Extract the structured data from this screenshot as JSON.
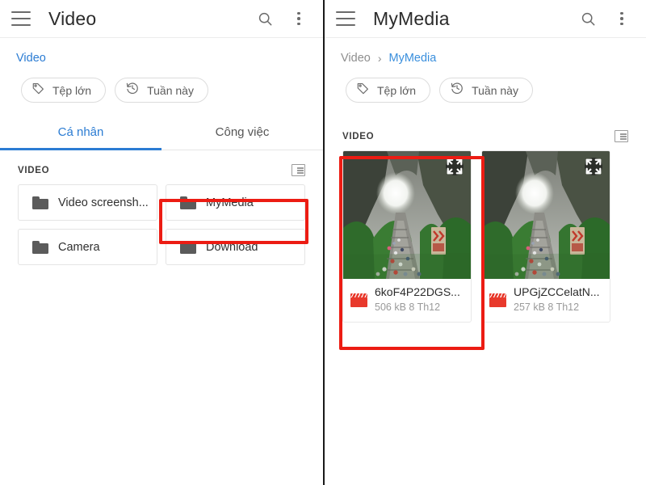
{
  "left_panel": {
    "appbar": {
      "menu_icon": "hamburger-menu-icon",
      "title": "Video",
      "search_icon": "search-icon",
      "overflow_icon": "more-vertical-icon"
    },
    "breadcrumb": [
      {
        "label": "Video",
        "state": "link"
      }
    ],
    "chips": [
      {
        "label": "Tệp lớn",
        "icon": "tag-icon"
      },
      {
        "label": "Tuần này",
        "icon": "history-icon"
      }
    ],
    "tabs": [
      {
        "label": "Cá nhân",
        "active": true
      },
      {
        "label": "Công việc",
        "active": false
      }
    ],
    "section": {
      "title": "VIDEO",
      "view_toggle_icon": "list-view-icon"
    },
    "folders": [
      {
        "name": "Video screensh...",
        "icon": "folder-icon"
      },
      {
        "name": "MyMedia",
        "icon": "folder-icon",
        "highlighted": true
      },
      {
        "name": "Camera",
        "icon": "folder-icon"
      },
      {
        "name": "Download",
        "icon": "folder-icon"
      }
    ]
  },
  "right_panel": {
    "appbar": {
      "menu_icon": "hamburger-menu-icon",
      "title": "MyMedia",
      "search_icon": "search-icon",
      "overflow_icon": "more-vertical-icon"
    },
    "breadcrumb": [
      {
        "label": "Video",
        "state": "parent"
      },
      {
        "label": "MyMedia",
        "state": "current"
      }
    ],
    "breadcrumb_separator": "›",
    "chips": [
      {
        "label": "Tệp lớn",
        "icon": "tag-icon"
      },
      {
        "label": "Tuần này",
        "icon": "history-icon"
      }
    ],
    "section": {
      "title": "VIDEO",
      "view_toggle_icon": "list-view-icon"
    },
    "media": [
      {
        "name": "6koF4P22DGS...",
        "details": "506 kB 8 Th12",
        "type_icon": "clapperboard-icon",
        "expand_icon": "fullscreen-expand-icon",
        "highlighted": true
      },
      {
        "name": "UPGjZCCelatN...",
        "details": "257 kB 8 Th12",
        "type_icon": "clapperboard-icon",
        "expand_icon": "fullscreen-expand-icon",
        "highlighted": false
      }
    ]
  },
  "colors": {
    "accent_blue": "#2b7cd3",
    "highlight_red": "#ec1c13",
    "video_badge_red": "#e8392c",
    "folder_gray": "#5b5b5b"
  }
}
